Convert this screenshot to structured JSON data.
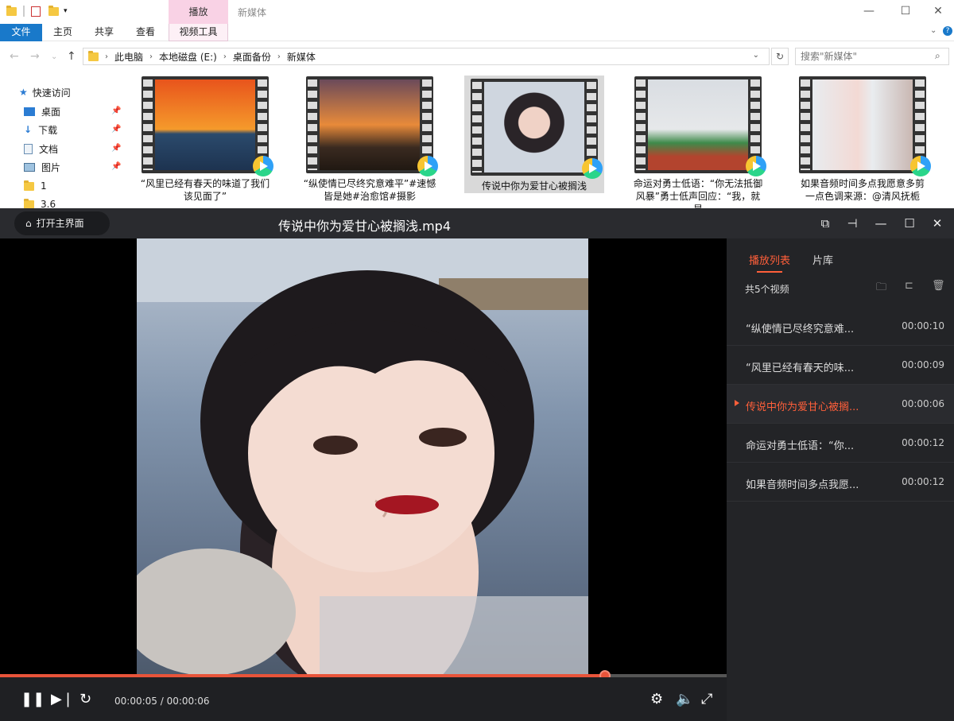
{
  "explorer": {
    "window_title": "新媒体",
    "context_tab": "播放",
    "ribbon_tabs": {
      "file": "文件",
      "home": "主页",
      "share": "共享",
      "view": "查看",
      "video_tools": "视频工具"
    },
    "breadcrumb": [
      "此电脑",
      "本地磁盘 (E:)",
      "桌面备份",
      "新媒体"
    ],
    "search_placeholder": "搜索\"新媒体\"",
    "nav": {
      "quick_access": "快速访问",
      "items": [
        {
          "label": "桌面",
          "icon": "desktop-icon"
        },
        {
          "label": "下载",
          "icon": "download-icon"
        },
        {
          "label": "文档",
          "icon": "document-icon"
        },
        {
          "label": "图片",
          "icon": "picture-icon"
        },
        {
          "label": "1",
          "icon": "folder-icon"
        },
        {
          "label": "3.6",
          "icon": "folder-icon"
        }
      ]
    },
    "files": [
      {
        "line1": "“风里已经有春天的味道了我们",
        "line2": "该见面了”"
      },
      {
        "line1": "“纵使情已尽终究意难平”#速憾",
        "line2": "皆是她#治愈馆#摄影"
      },
      {
        "line1": "传说中你为爱甘心被搁浅",
        "line2": ""
      },
      {
        "line1": "命运对勇士低语：“你无法抵御",
        "line2": "风暴”勇士低声回应：“我，就是"
      },
      {
        "line1": "如果音频时间多点我愿意多剪",
        "line2": "一点色调来源：@清风抚栀"
      }
    ]
  },
  "player": {
    "home_button": "打开主界面",
    "title": "传说中你为爱甘心被搁浅.mp4",
    "time_current": "00:00:05",
    "time_total": "00:00:06",
    "progress": 0.833,
    "tabs": {
      "playlist": "播放列表",
      "library": "片库"
    },
    "count_label": "共5个视频",
    "playlist": [
      {
        "name": "“纵使情已尽终究意难...",
        "duration": "00:00:10"
      },
      {
        "name": "“风里已经有春天的味...",
        "duration": "00:00:09"
      },
      {
        "name": "传说中你为爱甘心被搁...",
        "duration": "00:00:06"
      },
      {
        "name": "命运对勇士低语：“你...",
        "duration": "00:00:12"
      },
      {
        "name": "如果音频时间多点我愿...",
        "duration": "00:00:12"
      }
    ],
    "accent": "#ff5f3a"
  }
}
